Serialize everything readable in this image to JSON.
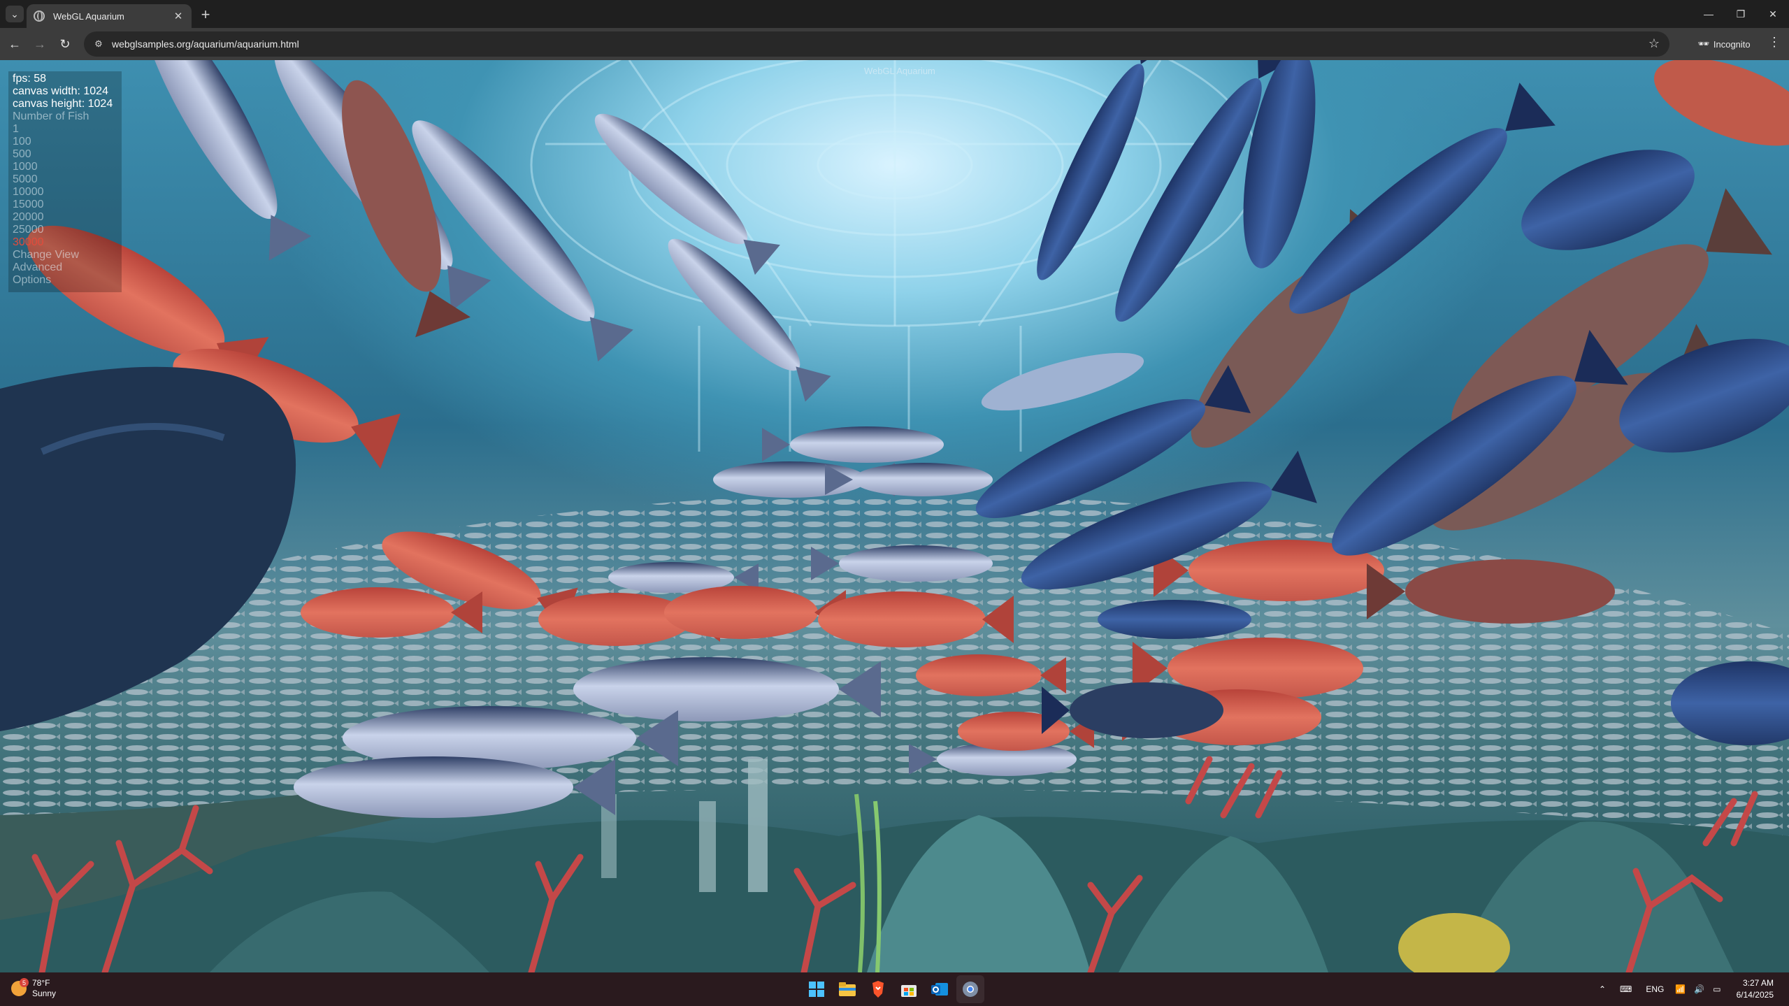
{
  "browser": {
    "tab_title": "WebGL Aquarium",
    "url": "webglsamples.org/aquarium/aquarium.html",
    "incognito_label": "Incognito",
    "new_tab_symbol": "+",
    "tab_close_symbol": "✕"
  },
  "canvas": {
    "title_text": "WebGL Aquarium",
    "hud": {
      "fps": "fps: 58",
      "canvas_width": "canvas width: 1024",
      "canvas_height": "canvas height: 1024",
      "number_of_fish_label": "Number of Fish",
      "fish_options": [
        "1",
        "100",
        "500",
        "1000",
        "5000",
        "10000",
        "15000",
        "20000",
        "25000",
        "30000"
      ],
      "selected_fish_option": "30000",
      "change_view": "Change View",
      "advanced": "Advanced",
      "options": "Options"
    }
  },
  "taskbar": {
    "weather_temp": "78°F",
    "weather_desc": "Sunny",
    "weather_badge": "5",
    "language": "ENG",
    "time": "3:27 AM",
    "date": "6/14/2025",
    "apps": [
      "windows-start",
      "file-explorer",
      "brave-browser",
      "microsoft-store",
      "outlook",
      "chrome"
    ]
  },
  "colors": {
    "accent_selected": "#e24b3c",
    "chrome_dark": "#1f1f1f",
    "toolbar": "#3c3c3c",
    "water": "#3e8fb0"
  }
}
